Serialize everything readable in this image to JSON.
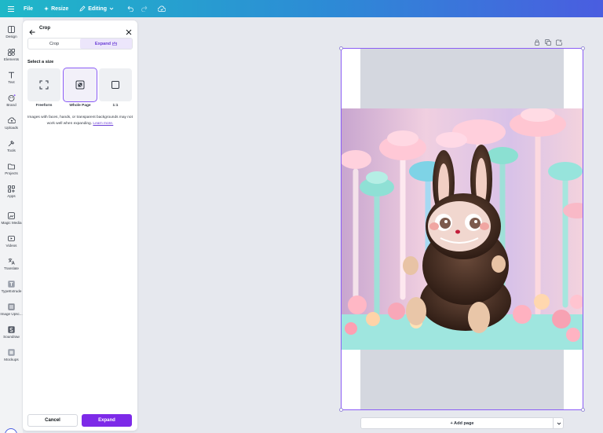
{
  "topbar": {
    "file_label": "File",
    "resize_label": "Resize",
    "editing_label": "Editing"
  },
  "rail": {
    "items": [
      {
        "label": "Design",
        "icon": "design-icon"
      },
      {
        "label": "Elements",
        "icon": "elements-icon"
      },
      {
        "label": "Text",
        "icon": "text-icon"
      },
      {
        "label": "Brand",
        "icon": "brand-icon"
      },
      {
        "label": "Uploads",
        "icon": "uploads-icon"
      },
      {
        "label": "Tools",
        "icon": "tools-icon"
      },
      {
        "label": "Projects",
        "icon": "projects-icon"
      },
      {
        "label": "Apps",
        "icon": "apps-icon"
      },
      {
        "label": "Magic Media",
        "icon": "magic-media-icon"
      },
      {
        "label": "Videos",
        "icon": "videos-icon"
      },
      {
        "label": "Translate",
        "icon": "translate-icon"
      },
      {
        "label": "TypeExtrude",
        "icon": "typeextrude-icon"
      },
      {
        "label": "Image Upsc...",
        "icon": "image-upscaler-icon"
      },
      {
        "label": "Soundraw",
        "icon": "soundraw-icon"
      },
      {
        "label": "Mockups",
        "icon": "mockups-icon"
      }
    ]
  },
  "panel": {
    "title": "Crop",
    "tabs": [
      {
        "label": "Crop",
        "active": false
      },
      {
        "label": "Expand",
        "active": true
      }
    ],
    "select_size_label": "Select a size",
    "sizes": [
      {
        "label": "Freeform",
        "selected": false
      },
      {
        "label": "Whole Page",
        "selected": true
      },
      {
        "label": "1:1",
        "selected": false
      }
    ],
    "note_text": "Images with faces, hands, or transparent backgrounds may not work well when expanding.",
    "learn_more": "Learn more.",
    "cancel_label": "Cancel",
    "expand_label": "Expand"
  },
  "canvas": {
    "add_page_label": "+ Add page",
    "accent_color": "#8b5cf6"
  }
}
